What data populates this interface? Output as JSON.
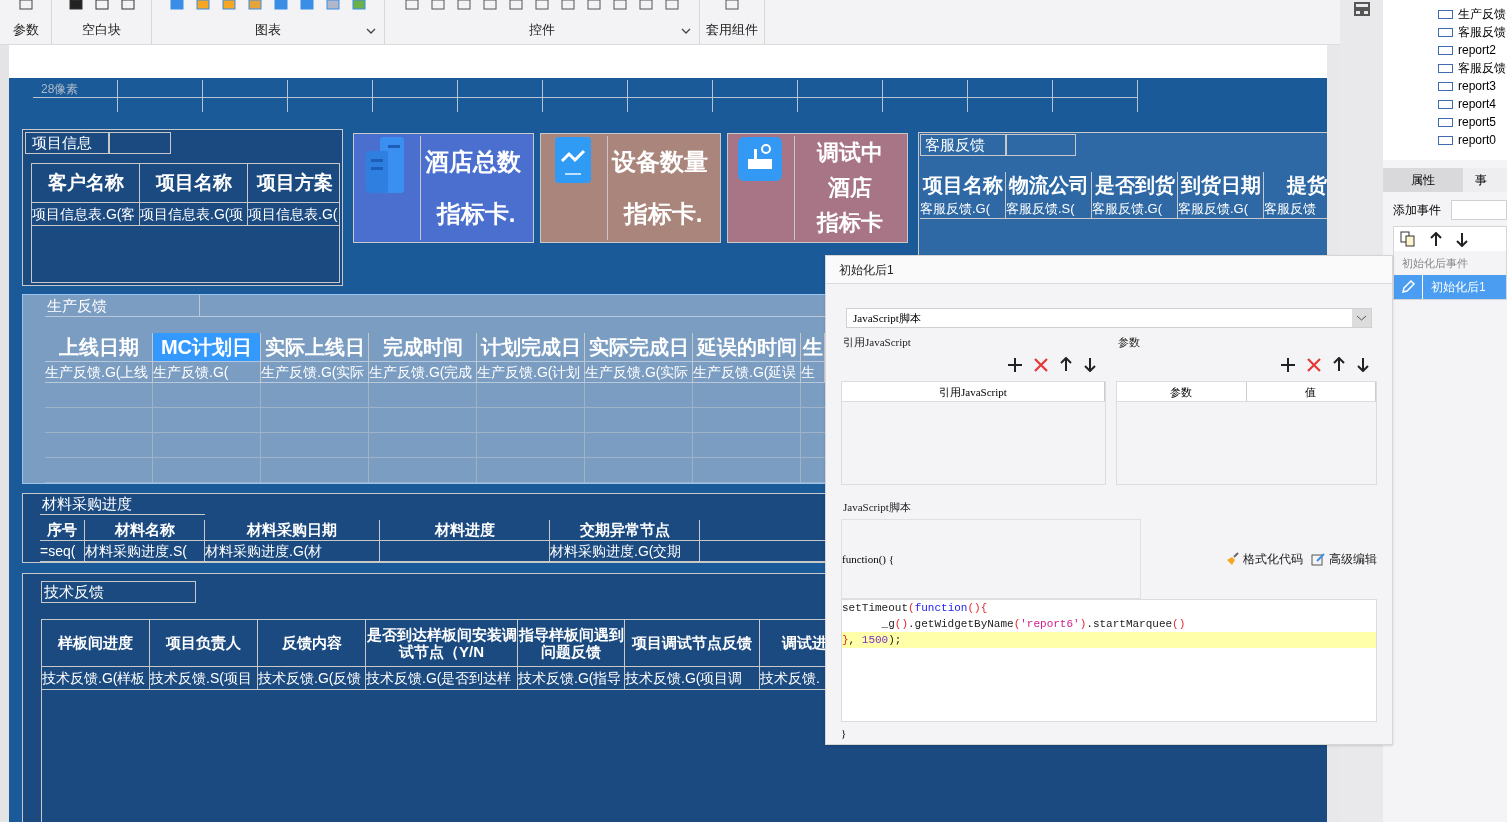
{
  "toolbar": {
    "groups": [
      {
        "label": "参数",
        "dropdown": false
      },
      {
        "label": "空白块",
        "dropdown": false
      },
      {
        "label": "图表",
        "dropdown": true
      },
      {
        "label": "控件",
        "dropdown": true
      },
      {
        "label": "套用组件",
        "dropdown": false
      }
    ]
  },
  "canvas": {
    "ruler_label": "28像素",
    "project_info": {
      "title": "项目信息",
      "columns": [
        {
          "header": "客户名称",
          "cell": "项目信息表.G(客"
        },
        {
          "header": "项目名称",
          "cell": "项目信息表.G(项"
        },
        {
          "header": "项目方案",
          "cell": "项目信息表.G("
        }
      ]
    },
    "kpi_cards": [
      {
        "kind": "building",
        "color": "#4a6fcf",
        "lines": [
          "酒店总数",
          "指标卡."
        ]
      },
      {
        "kind": "trend",
        "color": "#a9857b",
        "lines": [
          "设备数量",
          "指标卡."
        ]
      },
      {
        "kind": "device",
        "color": "#a87586",
        "lines": [
          "调试中",
          "酒店",
          "指标卡"
        ]
      }
    ],
    "customer_feedback": {
      "title": "客服反馈",
      "columns": [
        {
          "header": "项目名称",
          "cell": "客服反馈.G("
        },
        {
          "header": "物流公司",
          "cell": "客服反馈.S("
        },
        {
          "header": "是否到货",
          "cell": "客服反馈.G("
        },
        {
          "header": "到货日期",
          "cell": "客服反馈.G("
        },
        {
          "header": "提货",
          "cell": "客服反馈"
        }
      ]
    },
    "production": {
      "title": "生产反馈",
      "columns": [
        {
          "header": "上线日期",
          "cell": "生产反馈.G(上线",
          "selected": false
        },
        {
          "header": "MC计划日",
          "cell": "生产反馈.G(",
          "selected": true
        },
        {
          "header": "实际上线日",
          "cell": "生产反馈.G(实际",
          "selected": false
        },
        {
          "header": "完成时间",
          "cell": "生产反馈.G(完成",
          "selected": false
        },
        {
          "header": "计划完成日",
          "cell": "生产反馈.G(计划",
          "selected": false
        },
        {
          "header": "实际完成日",
          "cell": "生产反馈.G(实际",
          "selected": false
        },
        {
          "header": "延误的时间",
          "cell": "生产反馈.G(延误",
          "selected": false
        },
        {
          "header": "生",
          "cell": "生",
          "selected": false
        }
      ]
    },
    "material": {
      "title": "材料采购进度",
      "columns": [
        {
          "header": "序号",
          "cell": "=seq("
        },
        {
          "header": "材料名称",
          "cell": "材料采购进度.S("
        },
        {
          "header": "材料采购日期",
          "cell": "材料采购进度.G(材"
        },
        {
          "header": "材料进度"
        },
        {
          "header": "交期异常节点",
          "cell": "材料采购进度.G(交期"
        }
      ]
    },
    "tech": {
      "title": "技术反馈",
      "columns": [
        {
          "header": "样板间进度",
          "cell": "技术反馈.G(样板"
        },
        {
          "header": "项目负责人",
          "cell": "技术反馈.S(项目"
        },
        {
          "header": "反馈内容",
          "cell": "技术反馈.G(反馈"
        },
        {
          "header": "是否到达样板间安装调试节点（Y/N",
          "cell": "技术反馈.G(是否到达样"
        },
        {
          "header": "指导样板间遇到问题反馈",
          "cell": "技术反馈.G(指导"
        },
        {
          "header": "项目调试节点反馈",
          "cell": "技术反馈.G(项目调"
        },
        {
          "header": "调试进",
          "cell": "技术反馈."
        }
      ]
    }
  },
  "right_panel": {
    "tree": [
      "生产反馈",
      "客服反馈",
      "report2",
      "客服反馈",
      "report3",
      "report4",
      "report5",
      "report0"
    ],
    "tabs": [
      {
        "label": "属性",
        "selected": false
      },
      {
        "label": "事",
        "selected": true
      }
    ],
    "add_event_label": "添加事件",
    "event_group": "初始化后事件",
    "events": [
      {
        "label": "初始化后1",
        "selected": true
      }
    ]
  },
  "dialog": {
    "title": "初始化后1",
    "script_type": "JavaScript脚本",
    "ref_section": "引用JavaScript",
    "ref_columns": [
      "引用JavaScript"
    ],
    "param_section": "参数",
    "param_columns": [
      "参数",
      "值"
    ],
    "script_section": "JavaScript脚本",
    "function_header": "function() {",
    "actions": [
      "格式化代码",
      "高级编辑"
    ],
    "code": [
      {
        "highlighted": false,
        "tokens": [
          {
            "text": "setTimeout",
            "kind": "plain"
          },
          {
            "text": "(",
            "kind": "paren"
          },
          {
            "text": "function",
            "kind": "keyword"
          },
          {
            "text": "(){",
            "kind": "paren"
          }
        ]
      },
      {
        "highlighted": false,
        "tokens": [
          {
            "text": "      _g",
            "kind": "plain"
          },
          {
            "text": "()",
            "kind": "paren"
          },
          {
            "text": ".getWidgetByName",
            "kind": "plain"
          },
          {
            "text": "(",
            "kind": "paren"
          },
          {
            "text": "'report6'",
            "kind": "string"
          },
          {
            "text": ")",
            "kind": "paren"
          },
          {
            "text": ".startMarquee",
            "kind": "plain"
          },
          {
            "text": "()",
            "kind": "paren"
          }
        ]
      },
      {
        "highlighted": true,
        "tokens": [
          {
            "text": "}",
            "kind": "paren"
          },
          {
            "text": ", ",
            "kind": "plain"
          },
          {
            "text": "1500",
            "kind": "number"
          },
          {
            "text": ");",
            "kind": "plain"
          }
        ]
      }
    ],
    "function_footer": "}"
  }
}
